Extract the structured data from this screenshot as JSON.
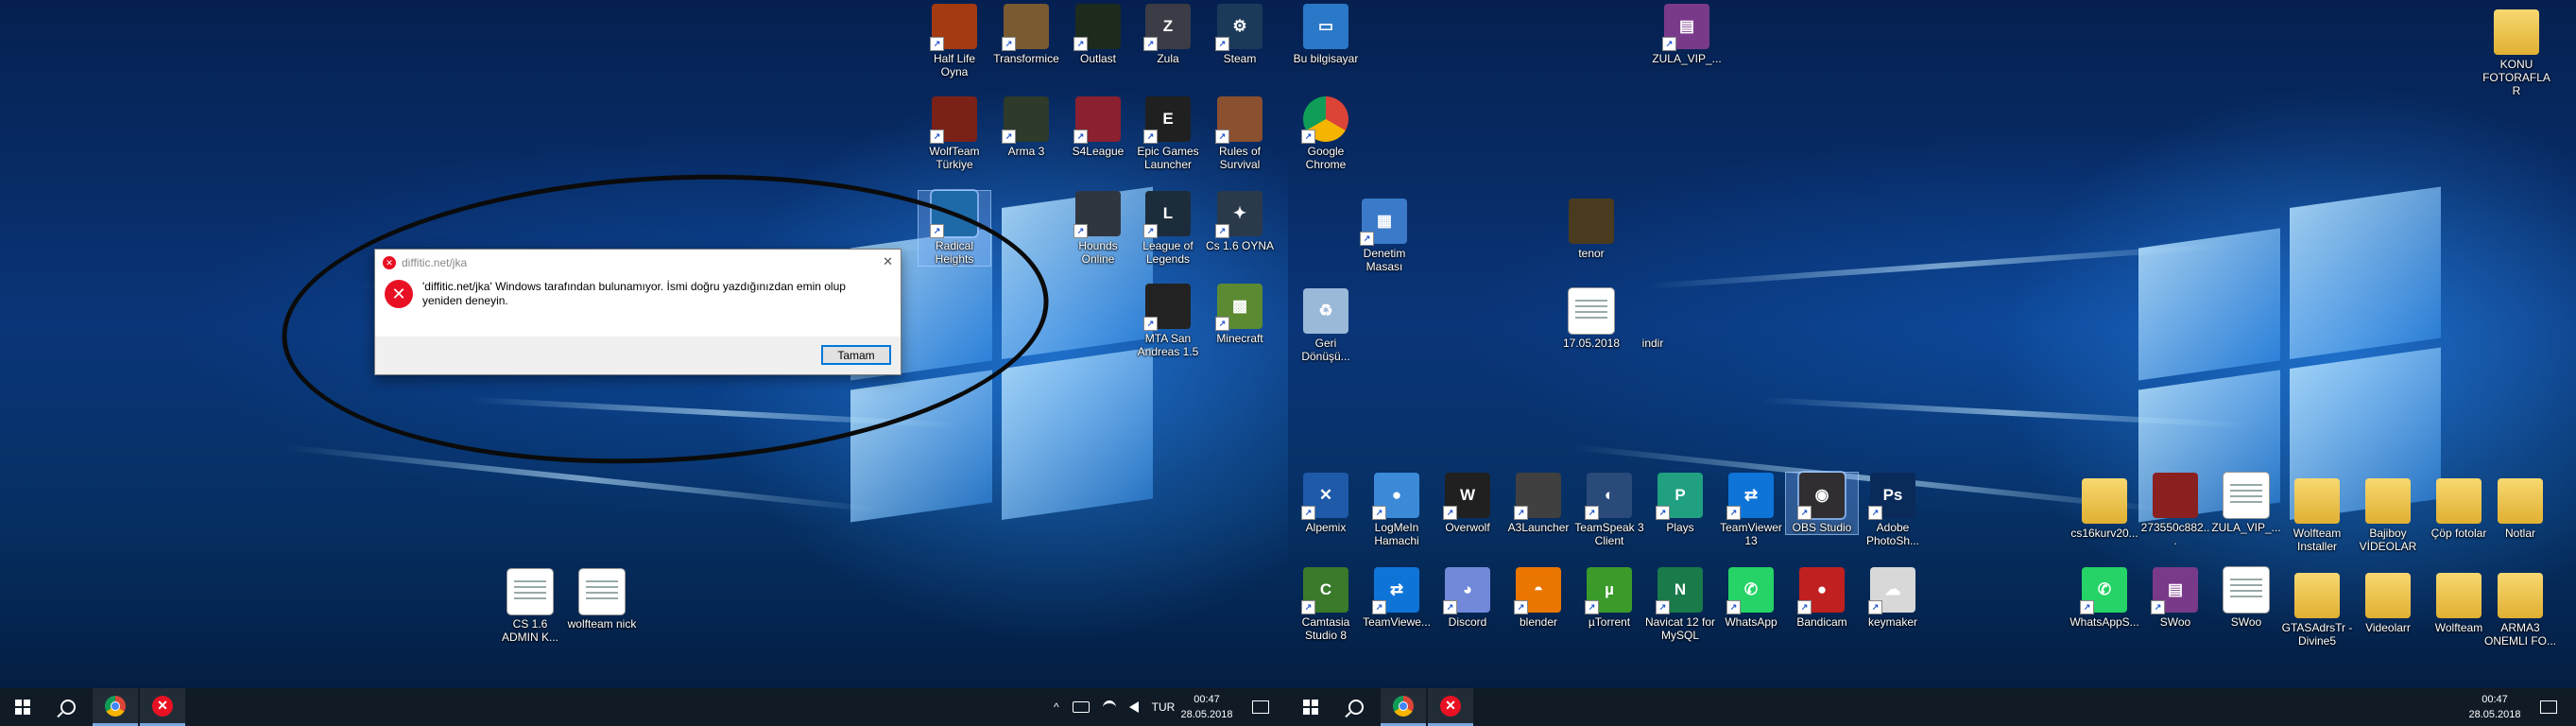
{
  "dialog": {
    "title": "diffitic.net/jka",
    "message": "'diffitic.net/jka' Windows tarafından bulunamıyor. İsmi doğru yazdığınızdan emin olup yeniden deneyin.",
    "ok_label": "Tamam",
    "close_glyph": "✕",
    "error_glyph": "✕"
  },
  "left_icons": [
    {
      "label": "Half Life Oyna",
      "icon": "half-life-icon",
      "color": "#a33a12"
    },
    {
      "label": "Transformice",
      "icon": "transformice-icon",
      "color": "#7a5a30"
    },
    {
      "label": "Outlast",
      "icon": "outlast-icon",
      "color": "#1d2b1d"
    },
    {
      "label": "Zula",
      "icon": "zula-icon",
      "color": "#3c3c46"
    },
    {
      "label": "Steam",
      "icon": "steam-icon",
      "color": "#1b3a5a"
    },
    {
      "label": "WolfTeam Türkiye",
      "icon": "wolfteam-icon",
      "color": "#7a2218"
    },
    {
      "label": "Arma 3",
      "icon": "arma3-icon",
      "color": "#2e3a2a"
    },
    {
      "label": "S4League",
      "icon": "s4league-icon",
      "color": "#8a2030"
    },
    {
      "label": "Epic Games Launcher",
      "icon": "epic-games-icon",
      "color": "#202020"
    },
    {
      "label": "Rules of Survival",
      "icon": "rules-of-survival-icon",
      "color": "#8a5030"
    },
    {
      "label": "Radical Heights",
      "icon": "radical-heights-icon",
      "color": "#1e6aa8"
    },
    {
      "label": "Hounds Online",
      "icon": "hounds-online-icon",
      "color": "#303640"
    },
    {
      "label": "League of Legends",
      "icon": "league-of-legends-icon",
      "color": "#1c2c3a"
    },
    {
      "label": "Cs 1.6 OYNA",
      "icon": "cs16-icon",
      "color": "#2a3a4a"
    },
    {
      "label": "MTA San Andreas 1.5",
      "icon": "mta-icon",
      "color": "#222222"
    },
    {
      "label": "Minecraft",
      "icon": "minecraft-icon",
      "color": "#5b8a32"
    },
    {
      "label": "CS 1.6 ADMIN K...",
      "icon": "document-icon",
      "color": "#ffffff"
    },
    {
      "label": "wolfteam nick",
      "icon": "document-icon",
      "color": "#ffffff"
    }
  ],
  "right_icons": [
    {
      "label": "Bu bilgisayar",
      "icon": "this-pc-icon",
      "color": "#2a78c8"
    },
    {
      "label": "ZULA_VIP_...",
      "icon": "winrar-icon",
      "color": "#7a3a8a"
    },
    {
      "label": "KONU FOTORAFLAR",
      "icon": "folder-icon",
      "color": "#e8c050"
    },
    {
      "label": "Google Chrome",
      "icon": "chrome-icon",
      "color": "#ffffff"
    },
    {
      "label": "Denetim Masası",
      "icon": "control-panel-icon",
      "color": "#3a7ac8"
    },
    {
      "label": "tenor",
      "icon": "image-icon",
      "color": "#4a3a20"
    },
    {
      "label": "Geri Dönüşü...",
      "icon": "recycle-bin-icon",
      "color": "#9ab8d8"
    },
    {
      "label": "17.05.2018",
      "icon": "document-icon",
      "color": "#ffffff"
    },
    {
      "label": "indir",
      "icon": "blank-icon",
      "color": "transparent"
    },
    {
      "label": "Alpemix",
      "icon": "alpemix-icon",
      "color": "#1e5aa8"
    },
    {
      "label": "LogMeIn Hamachi",
      "icon": "hamachi-icon",
      "color": "#3a8ad8"
    },
    {
      "label": "Overwolf",
      "icon": "overwolf-icon",
      "color": "#202020"
    },
    {
      "label": "A3Launcher",
      "icon": "a3launcher-icon",
      "color": "#404040"
    },
    {
      "label": "TeamSpeak 3 Client",
      "icon": "teamspeak-icon",
      "color": "#2a4a7a"
    },
    {
      "label": "Plays",
      "icon": "plays-icon",
      "color": "#20a080"
    },
    {
      "label": "TeamViewer 13",
      "icon": "teamviewer-icon",
      "color": "#0e74d8"
    },
    {
      "label": "OBS Studio",
      "icon": "obs-icon",
      "color": "#302e31"
    },
    {
      "label": "Adobe PhotoSh...",
      "icon": "photoshop-icon",
      "color": "#0a2a5a"
    },
    {
      "label": "Camtasia Studio 8",
      "icon": "camtasia-icon",
      "color": "#3a7a2a"
    },
    {
      "label": "TeamViewe...",
      "icon": "teamviewer-icon",
      "color": "#0e74d8"
    },
    {
      "label": "Discord",
      "icon": "discord-icon",
      "color": "#7289da"
    },
    {
      "label": "blender",
      "icon": "blender-icon",
      "color": "#ea7600"
    },
    {
      "label": "µTorrent",
      "icon": "utorrent-icon",
      "color": "#3a9a2a"
    },
    {
      "label": "Navicat 12 for MySQL",
      "icon": "navicat-icon",
      "color": "#1a7a4a"
    },
    {
      "label": "WhatsApp",
      "icon": "whatsapp-icon",
      "color": "#25d366"
    },
    {
      "label": "Bandicam",
      "icon": "bandicam-icon",
      "color": "#c02020"
    },
    {
      "label": "keymaker",
      "icon": "keymaker-icon",
      "color": "#d8d8d8"
    },
    {
      "label": "cs16kurv20...",
      "icon": "folder-icon",
      "color": "#e8c050"
    },
    {
      "label": "273550c882...",
      "icon": "image-icon",
      "color": "#8a2020"
    },
    {
      "label": "ZULA_VIP_...",
      "icon": "document-icon",
      "color": "#ffffff"
    },
    {
      "label": "Wolfteam Installer",
      "icon": "folder-icon",
      "color": "#e8c050"
    },
    {
      "label": "Bajiboy VİDEOLAR",
      "icon": "folder-icon",
      "color": "#e8c050"
    },
    {
      "label": "Çöp fotolar",
      "icon": "folder-icon",
      "color": "#e8c050"
    },
    {
      "label": "Notlar",
      "icon": "folder-icon",
      "color": "#e8c050"
    },
    {
      "label": "WhatsAppS...",
      "icon": "whatsapp-icon",
      "color": "#25d366"
    },
    {
      "label": "SWoo",
      "icon": "winrar-icon",
      "color": "#7a3a8a"
    },
    {
      "label": "SWoo",
      "icon": "document-icon",
      "color": "#ffffff"
    },
    {
      "label": "GTASAdrsTr - Divine5",
      "icon": "folder-icon",
      "color": "#e8c050"
    },
    {
      "label": "Videolarr",
      "icon": "folder-icon",
      "color": "#e8c050"
    },
    {
      "label": "Wolfteam",
      "icon": "folder-icon",
      "color": "#e8c050"
    },
    {
      "label": "ARMA3 ONEMLI FO...",
      "icon": "folder-icon",
      "color": "#e8c050"
    }
  ],
  "taskbar": {
    "tray_language": "TUR",
    "clock_time": "00:47",
    "clock_date": "28.05.2018",
    "tray_up": "^"
  }
}
